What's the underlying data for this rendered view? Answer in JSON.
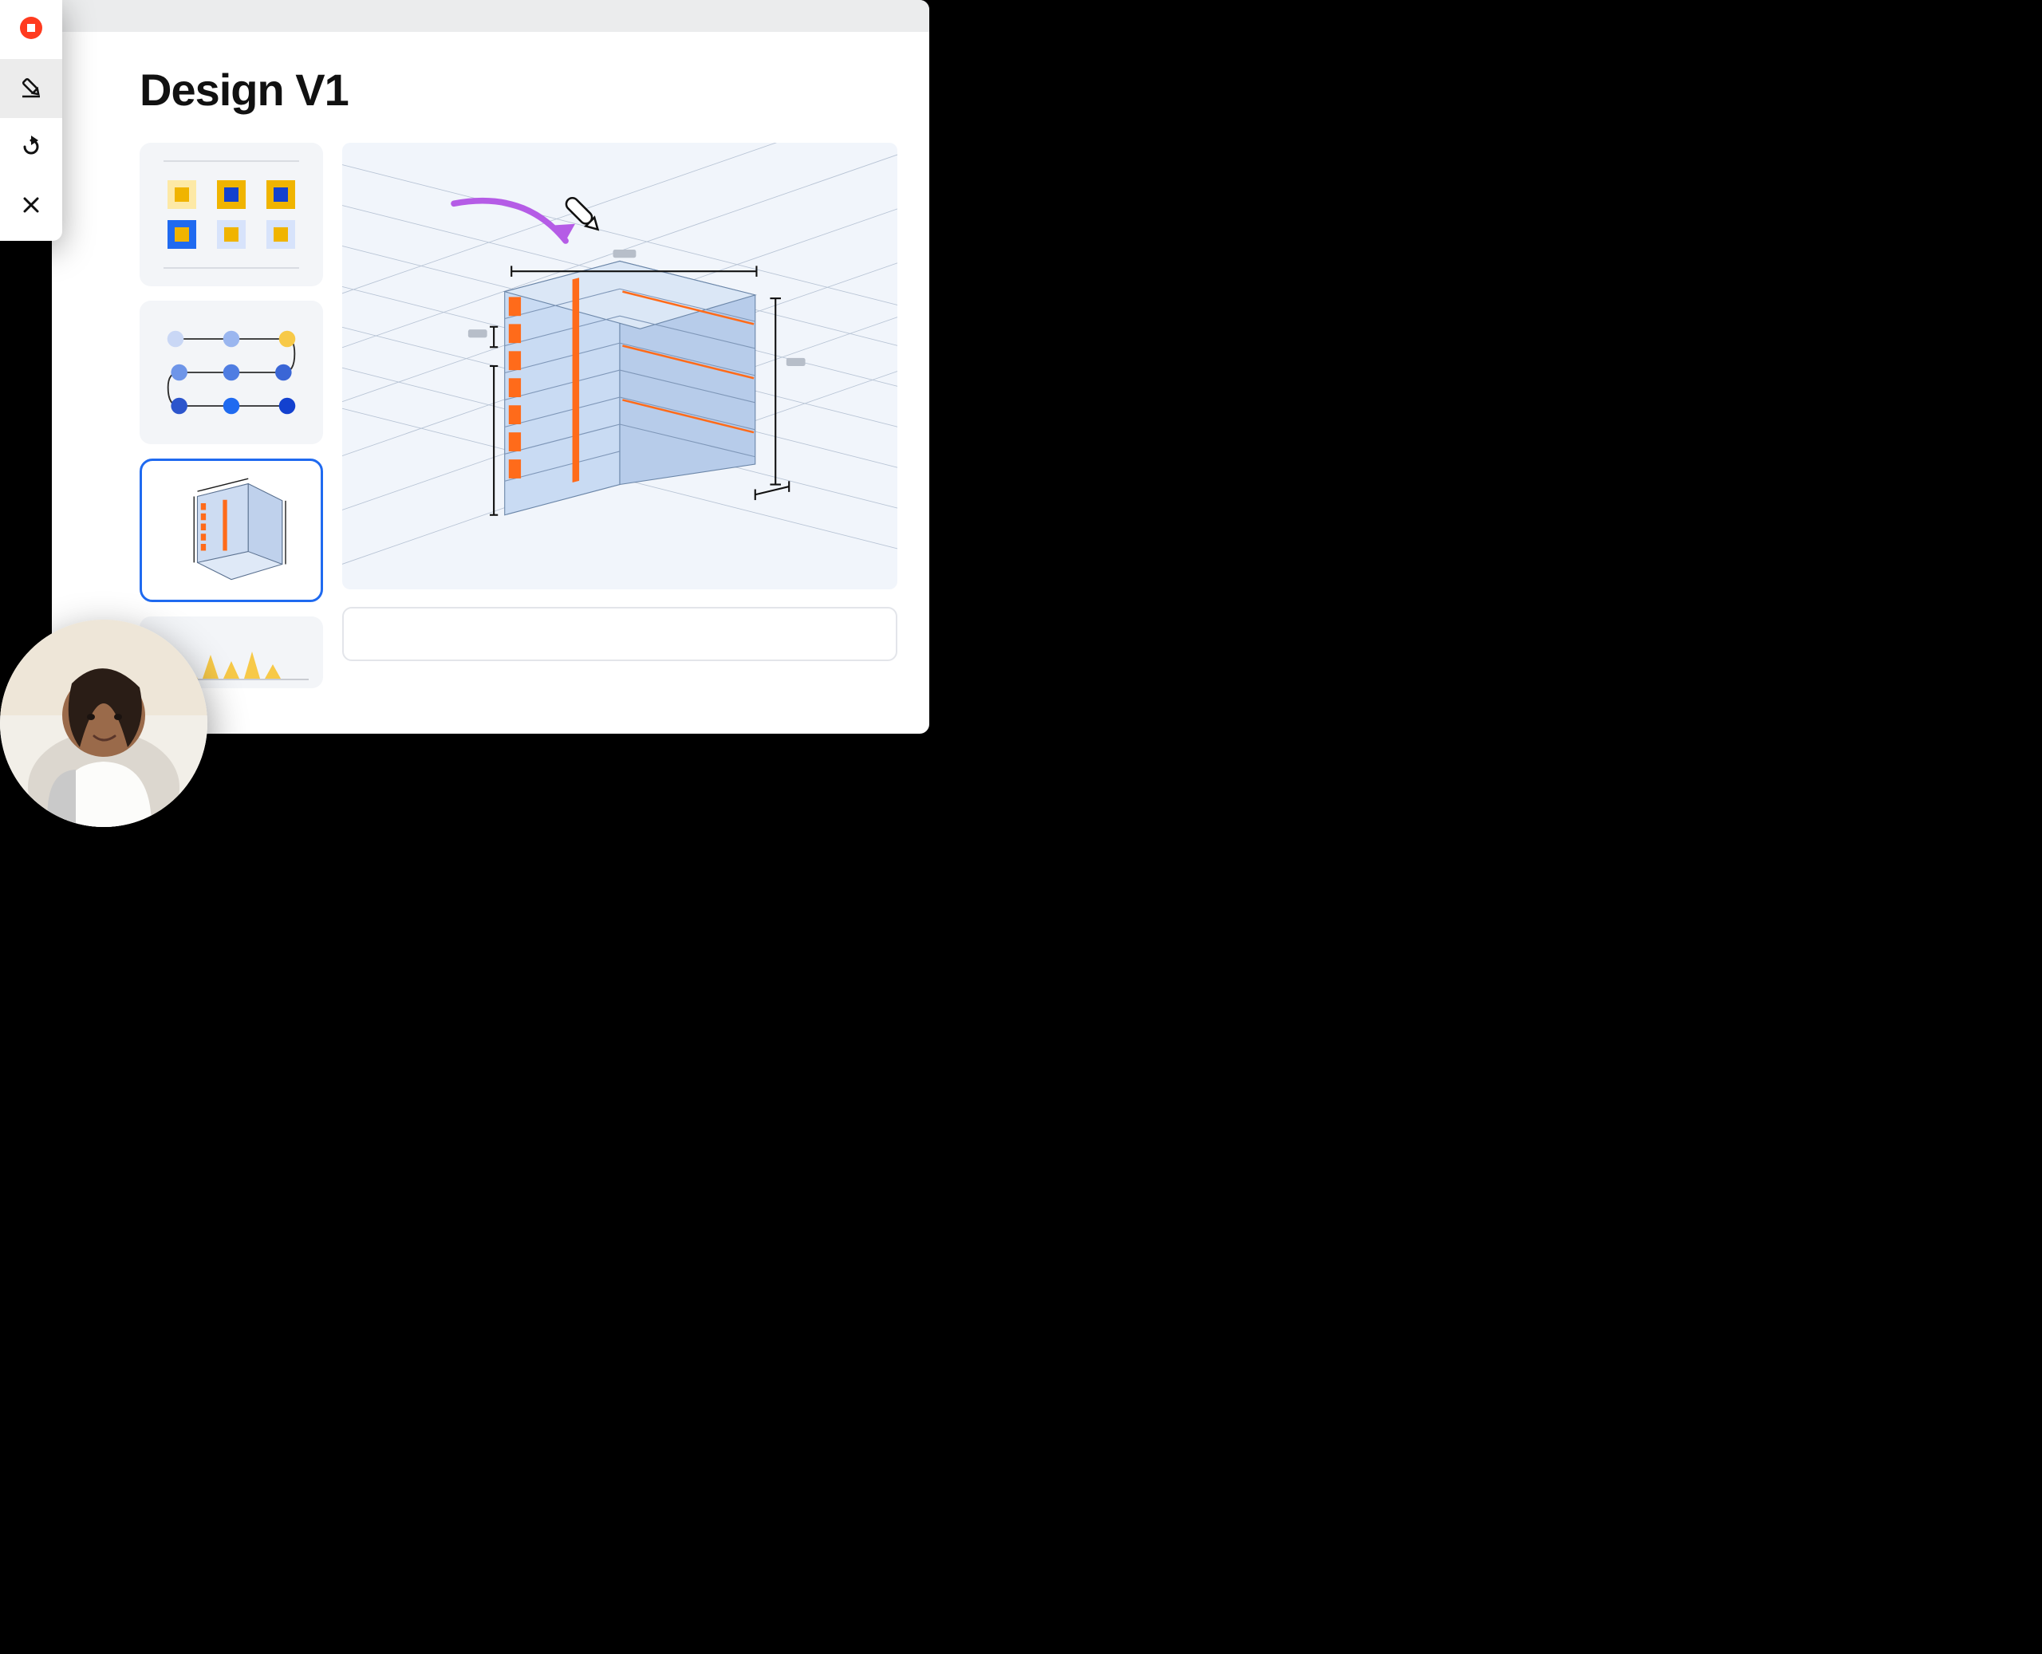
{
  "page": {
    "title": "Design V1"
  },
  "toolbar": {
    "items": [
      {
        "name": "record-button",
        "icon": "record-icon"
      },
      {
        "name": "draw-button",
        "icon": "pencil-icon",
        "active": true
      },
      {
        "name": "redo-button",
        "icon": "redo-icon"
      },
      {
        "name": "close-button",
        "icon": "close-icon"
      }
    ]
  },
  "thumbnails": [
    {
      "name": "thumb-swatches",
      "kind": "swatches"
    },
    {
      "name": "thumb-process",
      "kind": "process"
    },
    {
      "name": "thumb-building",
      "kind": "building",
      "selected": true
    },
    {
      "name": "thumb-chart",
      "kind": "chart"
    }
  ],
  "canvas": {
    "annotation_icon": "pencil-icon",
    "arrow_color": "#b55ce6"
  },
  "colors": {
    "accent_blue": "#1f6af0",
    "accent_orange": "#ff6b1a",
    "accent_yellow": "#f7c948",
    "accent_purple": "#b55ce6",
    "swatch_navy": "#1341cf",
    "swatch_gold": "#f0b400",
    "swatch_pale": "#d7e3fb",
    "swatch_light": "#fde9a6"
  },
  "avatar": {
    "name": "user-avatar"
  }
}
